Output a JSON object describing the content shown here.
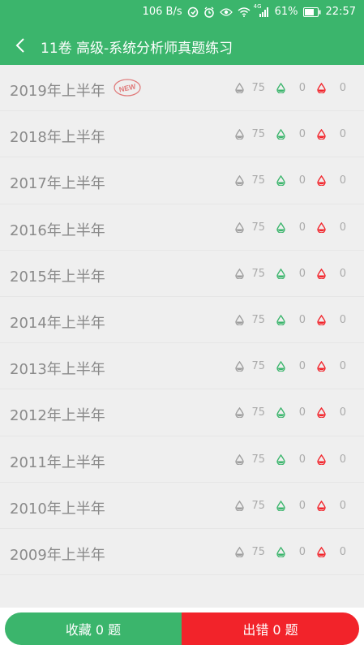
{
  "status_bar": {
    "speed": "106 B/s",
    "network": "4G",
    "battery": "61%",
    "time": "22:57"
  },
  "toolbar": {
    "title": "11卷 高级-系统分析师真题练习"
  },
  "badge_text": "NEW",
  "colors": {
    "primary": "#3bb56c",
    "danger": "#f2232a",
    "neutral_icon": "#9e9e9e"
  },
  "papers": [
    {
      "title": "2019年上半年",
      "is_new": true,
      "total": "75",
      "correct": "0",
      "wrong": "0"
    },
    {
      "title": "2018年上半年",
      "is_new": false,
      "total": "75",
      "correct": "0",
      "wrong": "0"
    },
    {
      "title": "2017年上半年",
      "is_new": false,
      "total": "75",
      "correct": "0",
      "wrong": "0"
    },
    {
      "title": "2016年上半年",
      "is_new": false,
      "total": "75",
      "correct": "0",
      "wrong": "0"
    },
    {
      "title": "2015年上半年",
      "is_new": false,
      "total": "75",
      "correct": "0",
      "wrong": "0"
    },
    {
      "title": "2014年上半年",
      "is_new": false,
      "total": "75",
      "correct": "0",
      "wrong": "0"
    },
    {
      "title": "2013年上半年",
      "is_new": false,
      "total": "75",
      "correct": "0",
      "wrong": "0"
    },
    {
      "title": "2012年上半年",
      "is_new": false,
      "total": "75",
      "correct": "0",
      "wrong": "0"
    },
    {
      "title": "2011年上半年",
      "is_new": false,
      "total": "75",
      "correct": "0",
      "wrong": "0"
    },
    {
      "title": "2010年上半年",
      "is_new": false,
      "total": "75",
      "correct": "0",
      "wrong": "0"
    },
    {
      "title": "2009年上半年",
      "is_new": false,
      "total": "75",
      "correct": "0",
      "wrong": "0"
    }
  ],
  "bottom": {
    "favorites_label": "收藏 0 题",
    "errors_label": "出错 0 题"
  }
}
